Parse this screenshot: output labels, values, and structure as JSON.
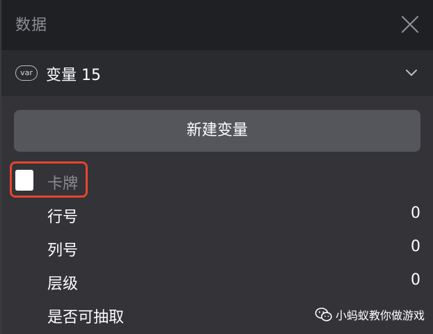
{
  "header": {
    "title": "数据",
    "close_icon": "close-icon"
  },
  "section": {
    "icon_text": "var",
    "title": "变量 15",
    "chevron_icon": "chevron-down-icon"
  },
  "new_variable_button": "新建变量",
  "group": {
    "label": "卡牌",
    "checked": false
  },
  "properties": [
    {
      "label": "行号",
      "value": "0"
    },
    {
      "label": "列号",
      "value": "0"
    },
    {
      "label": "层级",
      "value": "0"
    },
    {
      "label": "是否可抽取",
      "value": ""
    }
  ],
  "watermark": {
    "text": "小蚂蚁教你做游戏",
    "icon": "wechat-icon"
  },
  "colors": {
    "highlight": "#e8442f",
    "header_bg": "#1f2024",
    "button_bg": "#55565c"
  }
}
